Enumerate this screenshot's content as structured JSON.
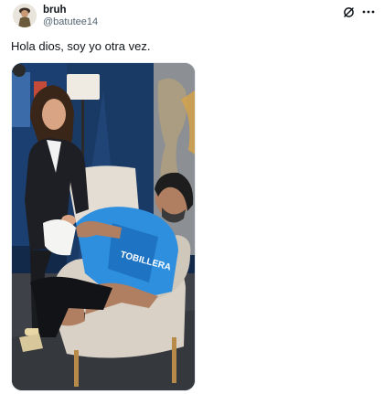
{
  "tweet": {
    "author": {
      "display_name": "bruh",
      "handle": "@batutee14",
      "avatar_icon": "avatar-figure"
    },
    "text": "Hola dios, soy yo otra vez.",
    "header_icons": [
      "grok-icon",
      "more-icon"
    ],
    "media": {
      "icon": "photo",
      "shirt_lettering": "TOBILLERA"
    }
  },
  "colors": {
    "text": "#0f1419",
    "secondary_text": "#536471",
    "shirt_blue": "#1e88d4",
    "wall_navy": "#152a4a"
  }
}
